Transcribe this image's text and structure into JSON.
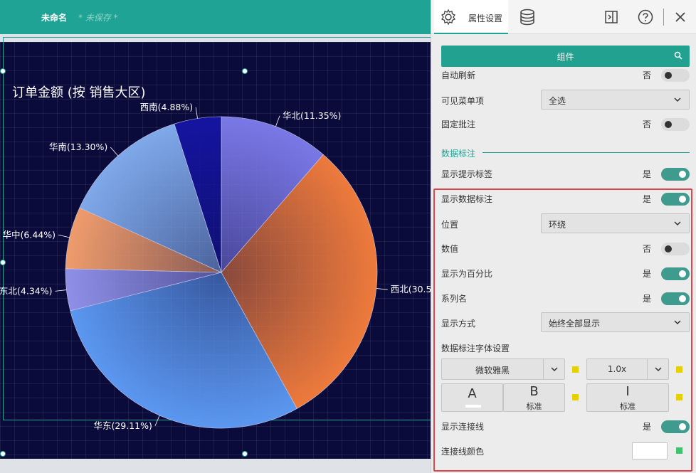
{
  "header": {
    "doc_name": "未命名",
    "unsaved": "* 未保存 *"
  },
  "panel": {
    "tab_props": "属性设置",
    "component_btn": "组件",
    "rows": {
      "auto_refresh": {
        "label": "自动刷新",
        "value": "否"
      },
      "visible_menu": {
        "label": "可见菜单项",
        "value": "全选"
      },
      "fixed_note": {
        "label": "固定批注",
        "value": "否"
      },
      "section_title": "数据标注",
      "show_tooltip": {
        "label": "显示提示标签",
        "value": "是"
      },
      "show_data_label": {
        "label": "显示数据标注",
        "value": "是"
      },
      "position": {
        "label": "位置",
        "value": "环绕"
      },
      "numeric": {
        "label": "数值",
        "value": "否"
      },
      "show_percent": {
        "label": "显示为百分比",
        "value": "是"
      },
      "series_name": {
        "label": "系列名",
        "value": "是"
      },
      "display_mode": {
        "label": "显示方式",
        "value": "始终全部显示"
      },
      "font_settings": {
        "label": "数据标注字体设置"
      },
      "font_family": "微软雅黑",
      "font_scale": "1.0x",
      "font_color_glyph": "A",
      "bold_glyph": "B",
      "bold_label": "标准",
      "italic_glyph": "I",
      "italic_label": "标准",
      "show_connector": {
        "label": "显示连接线",
        "value": "是"
      },
      "connector_color": {
        "label": "连接线颜色"
      }
    }
  },
  "chart_data": {
    "type": "pie",
    "title": "订单金额 (按 销售大区)",
    "slices": [
      {
        "name": "华北",
        "label": "华北(11.35%)",
        "value": 11.35,
        "color": "#7a78e6"
      },
      {
        "name": "西北",
        "label": "西北(30.5",
        "value": 30.58,
        "color": "#ee7a3c"
      },
      {
        "name": "华东",
        "label": "华东(29.11%)",
        "value": 29.11,
        "color": "#5b97f0"
      },
      {
        "name": "东北",
        "label": "东北(4.34%)",
        "value": 4.34,
        "color": "#8f8fe8"
      },
      {
        "name": "华中",
        "label": "华中(6.44%)",
        "value": 6.44,
        "color": "#ef9c6c"
      },
      {
        "name": "华南",
        "label": "华南(13.30%)",
        "value": 13.3,
        "color": "#7fa9ea"
      },
      {
        "name": "西南",
        "label": "西南(4.88%)",
        "value": 4.88,
        "color": "#1414a0"
      }
    ]
  }
}
